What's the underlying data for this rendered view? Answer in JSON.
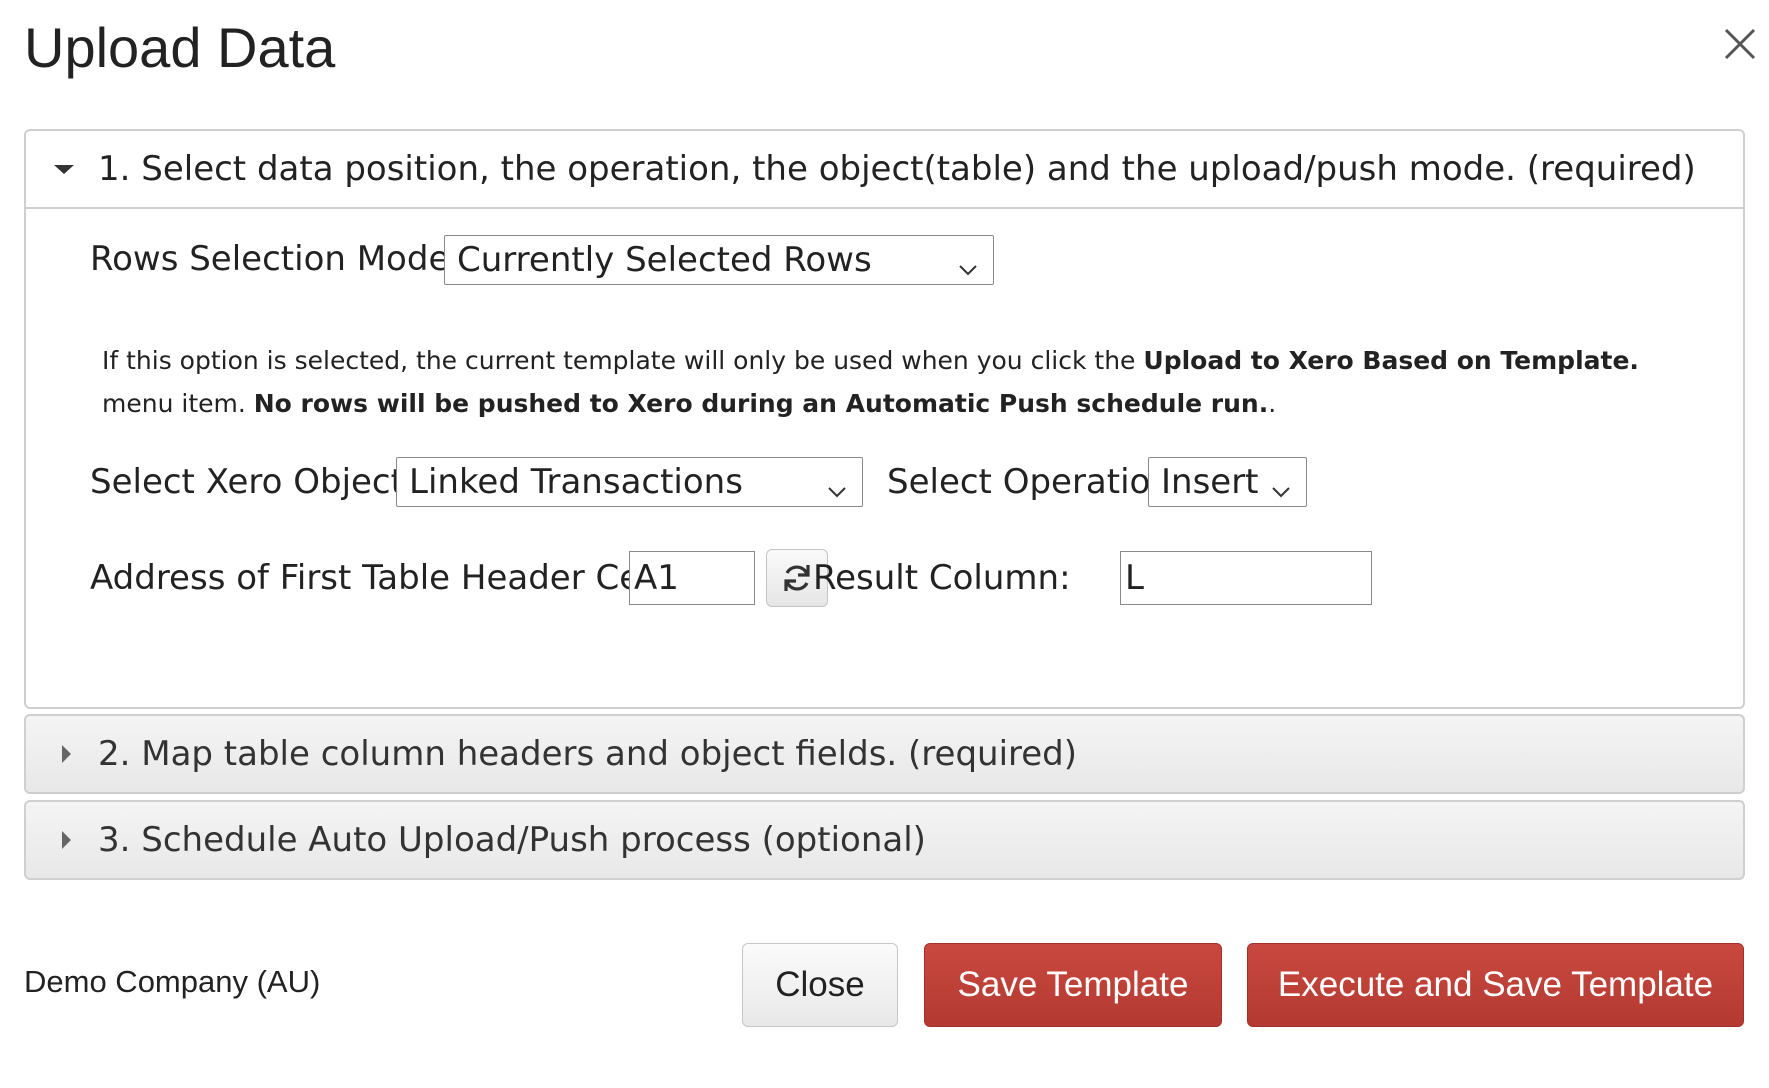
{
  "dialog": {
    "title": "Upload Data"
  },
  "sections": [
    {
      "label": "1. Select data position, the operation, the object(table) and the upload/push mode. (required)",
      "expanded": true
    },
    {
      "label": "2. Map table column headers and object fields. (required)",
      "expanded": false
    },
    {
      "label": "3. Schedule Auto Upload/Push process (optional)",
      "expanded": false
    }
  ],
  "form": {
    "rows_mode_label": "Rows Selection Mode:",
    "rows_mode_value": "Currently Selected Rows",
    "info_part1": "If this option is selected, the current template will only be used when you click the ",
    "info_bold1": "Upload to Xero Based on Template.",
    "info_part2": " menu item. ",
    "info_bold2": "No rows will be pushed to Xero during an Automatic Push schedule run.",
    "info_part3": ".",
    "object_label": "Select Xero Object:",
    "object_value": "Linked Transactions",
    "operation_label": "Select Operation:",
    "operation_value": "Insert",
    "address_label": "Address of First Table Header Cell:",
    "address_value": "A1",
    "result_label": "Result Column:",
    "result_value": "L"
  },
  "footer": {
    "company": "Demo Company (AU)",
    "close_label": "Close",
    "save_label": "Save Template",
    "execute_label": "Execute and Save Template"
  },
  "colors": {
    "primary_button": "#b33a31",
    "panel_border": "#cfcfcf"
  },
  "icons": [
    "close-icon",
    "caret-down-icon",
    "caret-right-icon",
    "chevron-down-icon",
    "refresh-icon"
  ]
}
